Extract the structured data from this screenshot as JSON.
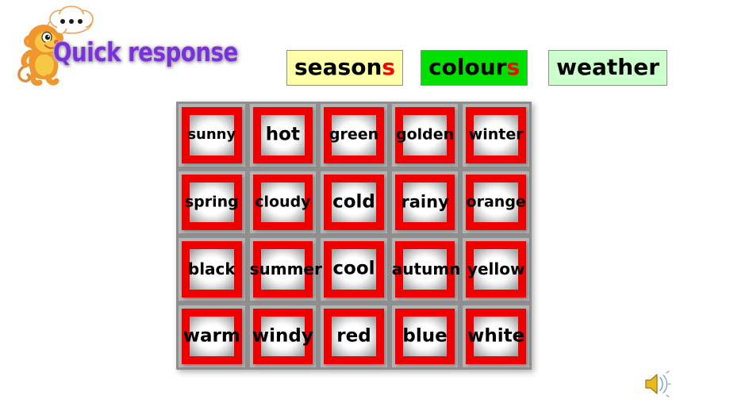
{
  "slide": {
    "title": "Quick response",
    "mascot": "monkey-with-speech-bubble",
    "background_color": "#ffffff"
  },
  "categories": [
    {
      "id": "seasons",
      "head": "season",
      "tail": "s",
      "label": "seasons",
      "bg_color": "#ffffaa",
      "tail_color": "#ff0000"
    },
    {
      "id": "colours",
      "head": "colour",
      "tail": "s",
      "label": "colours",
      "bg_color": "#00e000",
      "tail_color": "#ff0000"
    },
    {
      "id": "weather",
      "head": "weather",
      "tail": "",
      "label": "weather",
      "bg_color": "#ccffcc",
      "tail_color": "#ff0000"
    }
  ],
  "grid": {
    "columns": 5,
    "rows": 4,
    "frame_color": "#ee0000",
    "gridline_color": "#8f8f8f",
    "text_color": "#000000",
    "cells": [
      {
        "word": "sunny",
        "size": "18px"
      },
      {
        "word": "hot",
        "size": "23px"
      },
      {
        "word": "green",
        "size": "19px"
      },
      {
        "word": "golden",
        "size": "19px"
      },
      {
        "word": "winter",
        "size": "19px"
      },
      {
        "word": "spring",
        "size": "19px"
      },
      {
        "word": "cloudy",
        "size": "19px"
      },
      {
        "word": "cold",
        "size": "23px"
      },
      {
        "word": "rainy",
        "size": "21px"
      },
      {
        "word": "orange",
        "size": "19px"
      },
      {
        "word": "black",
        "size": "20px"
      },
      {
        "word": "summer",
        "size": "20px"
      },
      {
        "word": "cool",
        "size": "23px"
      },
      {
        "word": "autumn",
        "size": "20px"
      },
      {
        "word": "yellow",
        "size": "20px"
      },
      {
        "word": "warm",
        "size": "23px"
      },
      {
        "word": "windy",
        "size": "23px"
      },
      {
        "word": "red",
        "size": "23px"
      },
      {
        "word": "blue",
        "size": "23px"
      },
      {
        "word": "white",
        "size": "23px"
      }
    ]
  },
  "speaker": {
    "name": "speaker-icon",
    "color": "#e8b924"
  }
}
